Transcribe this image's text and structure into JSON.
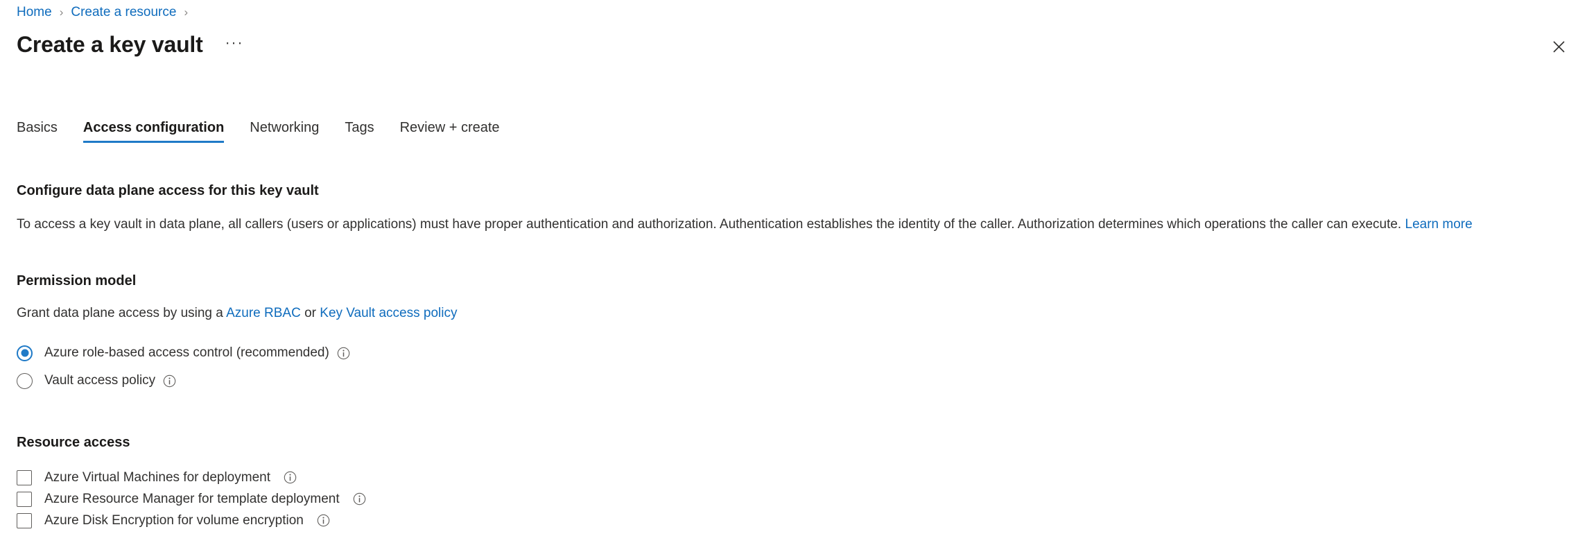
{
  "breadcrumb": {
    "items": [
      {
        "label": "Home"
      },
      {
        "label": "Create a resource"
      }
    ],
    "separator": "›"
  },
  "header": {
    "title": "Create a key vault",
    "ellipsis_label": "···",
    "close_icon": "close-icon"
  },
  "tabs": [
    {
      "label": "Basics",
      "active": false
    },
    {
      "label": "Access configuration",
      "active": true
    },
    {
      "label": "Networking",
      "active": false
    },
    {
      "label": "Tags",
      "active": false
    },
    {
      "label": "Review + create",
      "active": false
    }
  ],
  "main": {
    "configure_heading": "Configure data plane access for this key vault",
    "configure_description": "To access a key vault in data plane, all callers (users or applications) must have proper authentication and authorization. Authentication establishes the identity of the caller. Authorization determines which operations the caller can execute.",
    "configure_learn_more": "Learn more",
    "permission_model": {
      "heading": "Permission model",
      "description_prefix": "Grant data plane access by using a",
      "link_rbac": "Azure RBAC",
      "description_middle": "or",
      "link_policy": "Key Vault access policy",
      "options": [
        {
          "label": "Azure role-based access control (recommended)",
          "selected": true,
          "info": "info-icon"
        },
        {
          "label": "Vault access policy",
          "selected": false,
          "info": "info-icon"
        }
      ]
    },
    "resource_access": {
      "heading": "Resource access",
      "options": [
        {
          "label": "Azure Virtual Machines for deployment",
          "checked": false,
          "info": "info-icon"
        },
        {
          "label": "Azure Resource Manager for template deployment",
          "checked": false,
          "info": "info-icon"
        },
        {
          "label": "Azure Disk Encryption for volume encryption",
          "checked": false,
          "info": "info-icon"
        }
      ]
    }
  },
  "colors": {
    "accent": "#1f7ac7",
    "link": "#0f6cbd",
    "text": "#323130",
    "heading": "#1b1a19",
    "border": "#605e5c"
  }
}
